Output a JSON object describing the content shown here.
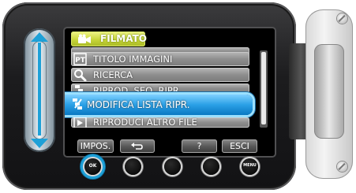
{
  "screen": {
    "header": {
      "label": "FILMATO",
      "icon": "movie-camera-icon"
    },
    "menu_items": [
      {
        "label": "TITOLO IMMAGINI",
        "icon": "pt-icon"
      },
      {
        "label": "RICERCA",
        "icon": "magnifier-icon"
      },
      {
        "label": "RIPROD. SEQ. RIPR.",
        "icon": "playlist-icon"
      },
      {
        "label": "MODIFICA LISTA RIPR.",
        "icon": "edit-playlist-icon",
        "selected": true
      },
      {
        "label": "RIPRODUCI ALTRO FILE",
        "icon": "play-other-icon"
      }
    ],
    "buttons": {
      "impos": "IMPOS.",
      "help": "?",
      "exit": "ESCI"
    }
  },
  "hardware": {
    "ok_label": "OK",
    "menu_label": "MENU"
  },
  "colors": {
    "accent": "#1ea0d7",
    "header": "#c8d63a",
    "selected": "#2aa0e6"
  }
}
